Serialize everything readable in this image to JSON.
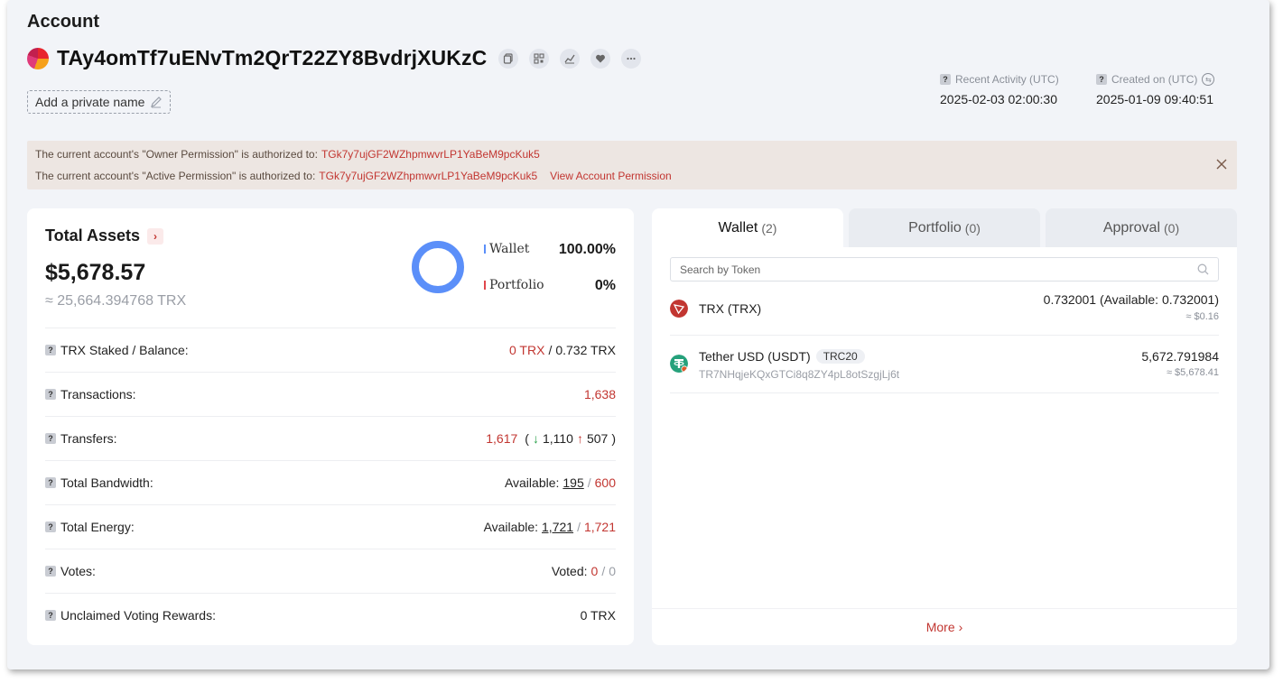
{
  "header": {
    "title": "Account",
    "address": "TAy4omTf7uENvTm2QrT22ZY8BvdrjXUKzC",
    "private_name_label": "Add a private name",
    "recent_activity_label": "Recent Activity (UTC)",
    "recent_activity_value": "2025-02-03 02:00:30",
    "created_on_label": "Created on (UTC)",
    "created_on_value": "2025-01-09 09:40:51",
    "icons": [
      "copy-icon",
      "qr-code-icon",
      "chart-icon",
      "heart-icon",
      "more-icon"
    ]
  },
  "banner": {
    "owner_text": "The current account's \"Owner Permission\" is authorized to:",
    "owner_address": "TGk7y7ujGF2WZhpmwvrLP1YaBeM9pcKuk5",
    "active_text": "The current account's \"Active Permission\" is authorized to:",
    "active_address": "TGk7y7ujGF2WZhpmwvrLP1YaBeM9pcKuk5",
    "link": "View Account Permission"
  },
  "assets": {
    "title": "Total Assets",
    "value": "$5,678.57",
    "trx_equiv": "≈ 25,664.394768 TRX",
    "legend": [
      {
        "label": "Wallet",
        "pct": "100.00%",
        "color": "#5b8ff9"
      },
      {
        "label": "Portfolio",
        "pct": "0%",
        "color": "#e0474c"
      }
    ],
    "donut_fraction": 1.0,
    "rows": {
      "staked_label": "TRX Staked / Balance:",
      "staked_value": "0 TRX",
      "sep": "/",
      "balance_value": "0.732 TRX",
      "tx_label": "Transactions:",
      "tx_value": "1,638",
      "transfers_label": "Transfers:",
      "transfers_total": "1,617",
      "transfers_open": "(",
      "transfers_in": "1,110",
      "transfers_out": "507",
      "transfers_close": ")",
      "bandwidth_label": "Total Bandwidth:",
      "available_label": "Available:",
      "bandwidth_available": "195",
      "bandwidth_total": "600",
      "energy_label": "Total Energy:",
      "energy_available": "1,721",
      "energy_total": "1,721",
      "votes_label": "Votes:",
      "voted_label": "Voted:",
      "votes_used": "0",
      "votes_total": "0",
      "rewards_label": "Unclaimed Voting Rewards:",
      "rewards_value": "0 TRX"
    }
  },
  "wallet": {
    "tabs": [
      {
        "label": "Wallet",
        "count": "(2)"
      },
      {
        "label": "Portfolio",
        "count": "(0)"
      },
      {
        "label": "Approval",
        "count": "(0)"
      }
    ],
    "search_placeholder": "Search by Token",
    "tokens": [
      {
        "name": "TRX (TRX)",
        "amount": "0.732001 (Available: 0.732001)",
        "usd": "≈ $0.16",
        "color": "#c23631"
      },
      {
        "name": "Tether USD (USDT)",
        "badge": "TRC20",
        "contract": "TR7NHqjeKQxGTCi8q8ZY4pL8otSzgjLj6t",
        "amount": "5,672.791984",
        "usd": "≈ $5,678.41",
        "color": "#26a17b"
      }
    ],
    "more_label": "More"
  }
}
